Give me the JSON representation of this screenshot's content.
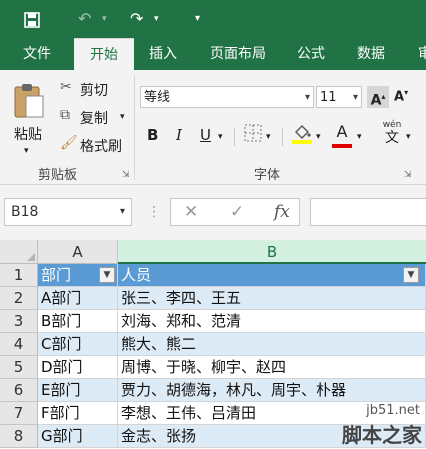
{
  "qat": {
    "save_icon": "save-icon",
    "undo_icon": "undo-icon",
    "redo_icon": "redo-icon",
    "customize_icon": "customize-icon"
  },
  "tabs": [
    "文件",
    "开始",
    "插入",
    "页面布局",
    "公式",
    "数据",
    "审"
  ],
  "clipboard": {
    "paste": "粘贴",
    "cut": "剪切",
    "copy": "复制",
    "format_painter": "格式刷",
    "group": "剪贴板"
  },
  "font": {
    "name": "等线",
    "size": "11",
    "group": "字体",
    "bold": "B",
    "italic": "I",
    "underline": "U",
    "font_color_glyph": "A",
    "grow": "A",
    "shrink": "A",
    "wen": "wén",
    "wen_char": "文"
  },
  "formula_bar": {
    "name_box": "B18",
    "fx": "fx"
  },
  "columns": [
    "A",
    "B"
  ],
  "rows": [
    {
      "num": "1",
      "a": "部门",
      "b": "人员"
    },
    {
      "num": "2",
      "a": "A部门",
      "b": "张三、李四、王五"
    },
    {
      "num": "3",
      "a": "B部门",
      "b": "刘海、郑和、范清"
    },
    {
      "num": "4",
      "a": "C部门",
      "b": "熊大、熊二"
    },
    {
      "num": "5",
      "a": "D部门",
      "b": "周博、于晓、柳宇、赵四"
    },
    {
      "num": "6",
      "a": "E部门",
      "b": "贾力、胡德海，林凡、周宇、朴器"
    },
    {
      "num": "7",
      "a": "F部门",
      "b": "李想、王伟、吕清田"
    },
    {
      "num": "8",
      "a": "G部门",
      "b": "金志、张扬"
    }
  ],
  "watermark": {
    "url": "jb51.net",
    "brand": "脚本之家"
  },
  "colors": {
    "accent": "#217346",
    "header_fill": "#5b9bd5",
    "band_fill": "#ddebf7"
  }
}
